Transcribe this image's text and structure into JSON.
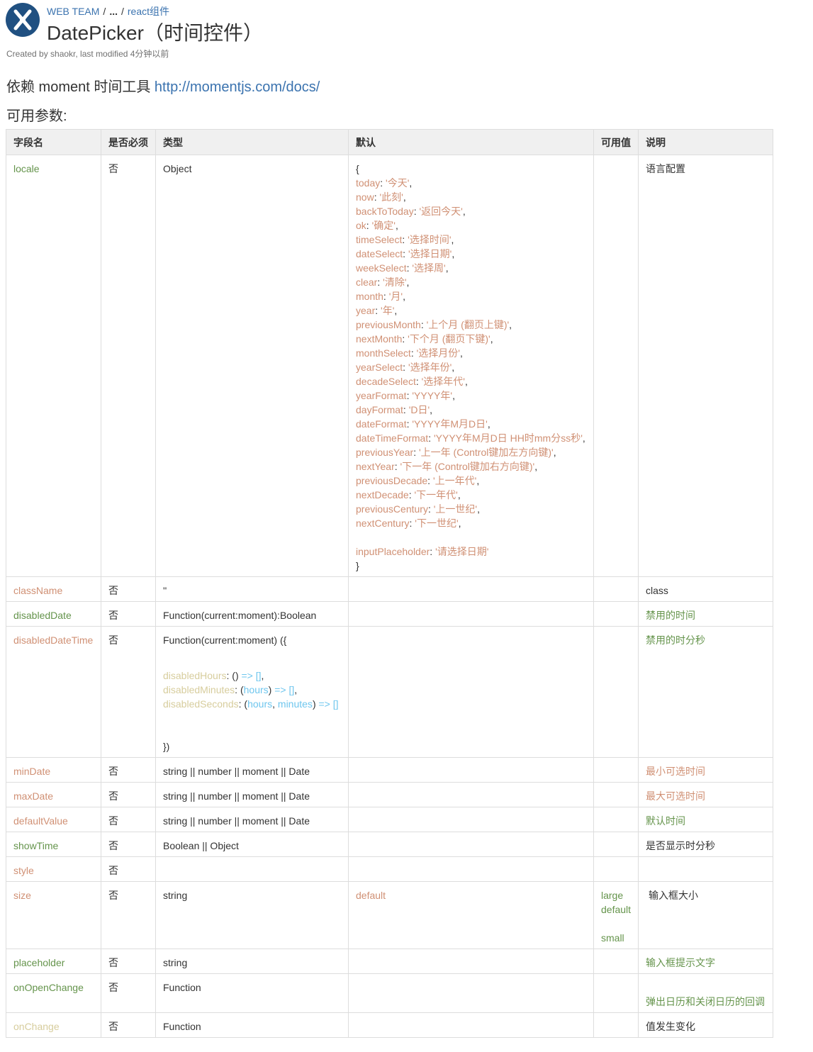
{
  "breadcrumb": {
    "space": "WEB TEAM",
    "ellipsis": "...",
    "parent": "react组件"
  },
  "page_title": "DatePicker（时间控件）",
  "meta": "Created by shaokr, last modified 4分钟以前",
  "dependency": {
    "text": "依赖 moment 时间工具 ",
    "link": "http://momentjs.com/docs/"
  },
  "params_heading": "可用参数:",
  "table": {
    "headers": [
      "字段名",
      "是否必须",
      "类型",
      "默认",
      "可用值",
      "说明"
    ],
    "locale_row": {
      "name": "locale",
      "required": "否",
      "type": "Object",
      "desc": "语言配置",
      "open": "{",
      "close": "}",
      "entries": [
        {
          "k": "today",
          "v": "'今天'"
        },
        {
          "k": "now",
          "v": "'此刻'"
        },
        {
          "k": "backToToday",
          "v": "'返回今天'"
        },
        {
          "k": "ok",
          "v": "'确定'"
        },
        {
          "k": "timeSelect",
          "v": "'选择时间'"
        },
        {
          "k": "dateSelect",
          "v": "'选择日期'"
        },
        {
          "k": "weekSelect",
          "v": "'选择周'"
        },
        {
          "k": "clear",
          "v": "'清除'"
        },
        {
          "k": "month",
          "v": "'月'"
        },
        {
          "k": "year",
          "v": "'年'"
        },
        {
          "k": "previousMonth",
          "v": "'上个月 (翻页上键)'"
        },
        {
          "k": "nextMonth",
          "v": "'下个月 (翻页下键)'"
        },
        {
          "k": "monthSelect",
          "v": "'选择月份'"
        },
        {
          "k": "yearSelect",
          "v": "'选择年份'"
        },
        {
          "k": "decadeSelect",
          "v": "'选择年代'"
        },
        {
          "k": "yearFormat",
          "v": "'YYYY年'"
        },
        {
          "k": "dayFormat",
          "v": "'D日'"
        },
        {
          "k": "dateFormat",
          "v": "'YYYY年M月D日'"
        },
        {
          "k": "dateTimeFormat",
          "v": "'YYYY年M月D日 HH时mm分ss秒'"
        },
        {
          "k": "previousYear",
          "v": "'上一年 (Control键加左方向键)'"
        },
        {
          "k": "nextYear",
          "v": "'下一年 (Control键加右方向键)'"
        },
        {
          "k": "previousDecade",
          "v": "'上一年代'"
        },
        {
          "k": "nextDecade",
          "v": "'下一年代'"
        },
        {
          "k": "previousCentury",
          "v": "'上一世纪'"
        },
        {
          "k": "nextCentury",
          "v": "'下一世纪'"
        }
      ],
      "last_entry": {
        "k": "inputPlaceholder",
        "v": "'请选择日期'"
      }
    },
    "className": {
      "name": "className",
      "required": "否",
      "type": "''",
      "desc": "class"
    },
    "disabledDate": {
      "name": "disabledDate",
      "required": "否",
      "type": "Function(current:moment):Boolean",
      "desc": "禁用的时间"
    },
    "disabledDateTime": {
      "name": "disabledDateTime",
      "required": "否",
      "type_open": "Function(current:moment) ({",
      "type_close": "})",
      "h_key": "disabledHours",
      "h_args": "()",
      "m_key": "disabledMinutes",
      "m_arg": "hours",
      "s_key": "disabledSeconds",
      "s_arg1": "hours",
      "s_arg2": "minutes",
      "arrow": "=>",
      "arr": "[]",
      "colon": ": ",
      "comma": ",",
      "lp": "(",
      "rp": ")",
      "desc": "禁用的时分秒"
    },
    "minDate": {
      "name": "minDate",
      "required": "否",
      "type": "string || number || moment || Date",
      "desc": "最小可选时间"
    },
    "maxDate": {
      "name": "maxDate",
      "required": "否",
      "type": "string || number || moment || Date",
      "desc": "最大可选时间"
    },
    "defaultValue": {
      "name": "defaultValue",
      "required": "否",
      "type": "string || number || moment || Date",
      "desc": "默认时间"
    },
    "showTime": {
      "name": "showTime",
      "required": "否",
      "type": "Boolean || Object",
      "desc": "是否显示时分秒"
    },
    "style": {
      "name": "style",
      "required": "否"
    },
    "size": {
      "name": "size",
      "required": "否",
      "type": "string",
      "default": "default",
      "values": [
        "large",
        "default",
        "small"
      ],
      "desc": "输入框大小"
    },
    "placeholder": {
      "name": "placeholder",
      "required": "否",
      "type": "string",
      "desc": "输入框提示文字"
    },
    "onOpenChange": {
      "name": "onOpenChange",
      "required": "否",
      "type": "Function",
      "desc": "弹出日历和关闭日历的回调"
    },
    "onChange": {
      "name": "onChange",
      "required": "否",
      "type": "Function",
      "desc": "值发生变化"
    }
  },
  "colors": {
    "link": "#3b73af",
    "green": "#65944c",
    "orange": "#d09074",
    "header_bg": "#f0f0f0",
    "logo": "#205081"
  }
}
